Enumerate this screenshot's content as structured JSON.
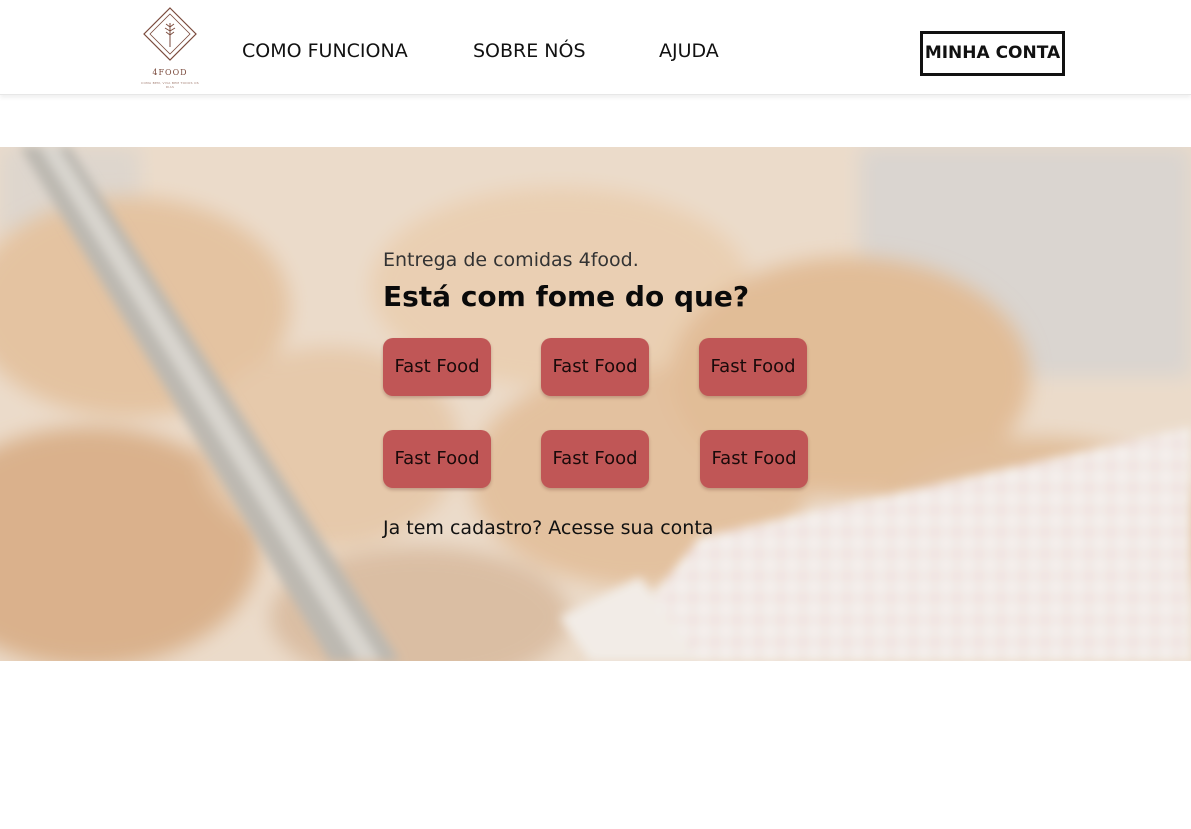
{
  "brand": {
    "name": "4FOOD",
    "tagline": "COMA BEM, VIVA BEM TODOS OS DIAS",
    "accent": "#7a4a3c"
  },
  "nav": {
    "items": [
      {
        "label": "COMO FUNCIONA"
      },
      {
        "label": "SOBRE NÓS"
      },
      {
        "label": "AJUDA"
      }
    ],
    "account_label": "MINHA CONTA"
  },
  "hero": {
    "subtitle": "Entrega de comidas 4food.",
    "headline": "Está com fome do que?",
    "categories": [
      {
        "label": "Fast Food"
      },
      {
        "label": "Fast Food"
      },
      {
        "label": "Fast Food"
      },
      {
        "label": "Fast Food"
      },
      {
        "label": "Fast Food"
      },
      {
        "label": "Fast Food"
      }
    ],
    "button_color": "#c05656",
    "signin_text": "Ja tem cadastro? Acesse sua conta"
  }
}
